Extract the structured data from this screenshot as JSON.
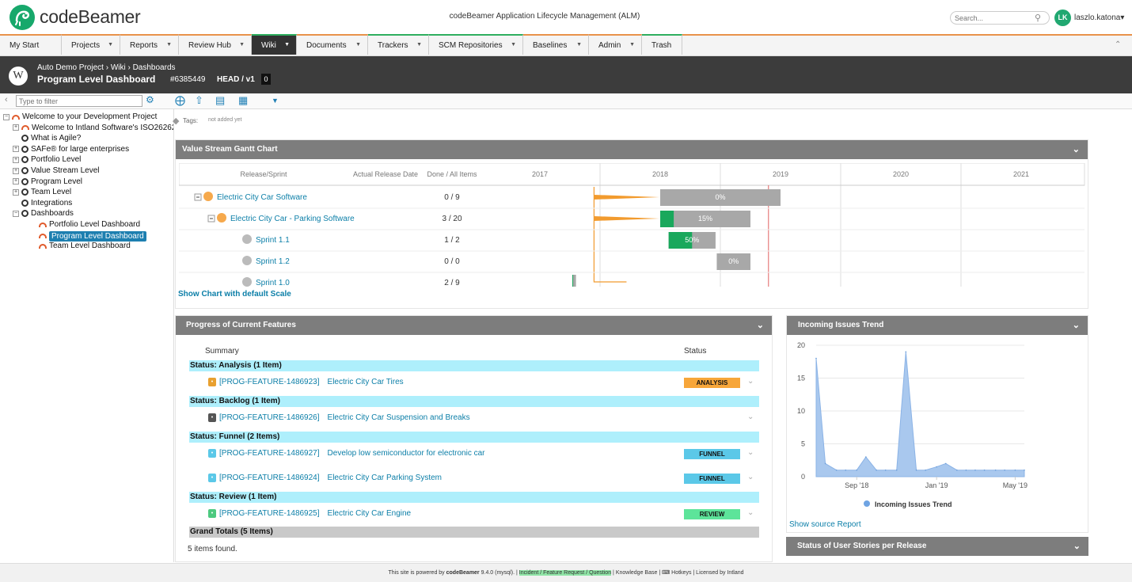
{
  "header": {
    "brand": "codeBeamer",
    "app_title": "codeBeamer Application Lifecycle Management (ALM)",
    "search_placeholder": "Search...",
    "avatar_initials": "LK",
    "username": "laszlo.katona▾"
  },
  "nav": {
    "tabs": [
      {
        "label": "My Start",
        "width": 78,
        "dd": false,
        "green": false,
        "active": false
      },
      {
        "label": "Projects",
        "width": 74,
        "dd": true,
        "green": false,
        "active": false
      },
      {
        "label": "Reports",
        "width": 74,
        "dd": true,
        "green": false,
        "active": false
      },
      {
        "label": "Review Hub",
        "width": 92,
        "dd": true,
        "green": false,
        "active": false
      },
      {
        "label": "Wiki",
        "width": 57,
        "dd": true,
        "green": true,
        "active": true
      },
      {
        "label": "Documents",
        "width": 90,
        "dd": true,
        "green": false,
        "active": false
      },
      {
        "label": "Trackers",
        "width": 77,
        "dd": true,
        "green": true,
        "active": false
      },
      {
        "label": "SCM Repositories",
        "width": 119,
        "dd": true,
        "green": true,
        "active": false
      },
      {
        "label": "Baselines",
        "width": 83,
        "dd": true,
        "green": false,
        "active": false
      },
      {
        "label": "Admin",
        "width": 67,
        "dd": true,
        "green": false,
        "active": false
      },
      {
        "label": "Trash",
        "width": 51,
        "dd": false,
        "green": true,
        "active": false
      }
    ]
  },
  "page": {
    "breadcrumb": "Auto Demo Project › Wiki › Dashboards",
    "title": "Program Level Dashboard",
    "id": "#6385449",
    "version": "HEAD / v1",
    "version_num": "0",
    "wiki_icon": "W"
  },
  "sidebar": {
    "filter_placeholder": "Type to filter",
    "tree": [
      {
        "label": "Welcome to your Development Project",
        "level": 0,
        "toggle": "−",
        "icon": "dashboard"
      },
      {
        "label": "Welcome to Intland Software's ISO26262",
        "level": 1,
        "toggle": "+",
        "icon": "dashboard"
      },
      {
        "label": "What is Agile?",
        "level": 1,
        "toggle": "",
        "icon": "page"
      },
      {
        "label": "SAFe® for large enterprises",
        "level": 1,
        "toggle": "+",
        "icon": "page"
      },
      {
        "label": "Portfolio Level",
        "level": 1,
        "toggle": "+",
        "icon": "page"
      },
      {
        "label": "Value Stream Level",
        "level": 1,
        "toggle": "+",
        "icon": "page"
      },
      {
        "label": "Program Level",
        "level": 1,
        "toggle": "+",
        "icon": "page"
      },
      {
        "label": "Team Level",
        "level": 1,
        "toggle": "+",
        "icon": "page"
      },
      {
        "label": "Integrations",
        "level": 1,
        "toggle": "",
        "icon": "page"
      },
      {
        "label": "Dashboards",
        "level": 1,
        "toggle": "−",
        "icon": "page"
      },
      {
        "label": "Portfolio Level Dashboard",
        "level": 2,
        "toggle": "",
        "icon": "dashboard"
      },
      {
        "label": "Program Level Dashboard",
        "level": 2,
        "toggle": "",
        "icon": "dashboard",
        "selected": true
      },
      {
        "label": "Team Level Dashboard",
        "level": 2,
        "toggle": "",
        "icon": "dashboard"
      }
    ]
  },
  "tags": {
    "label": "Tags:",
    "value": "not added yet"
  },
  "gantt": {
    "title": "Value Stream Gantt Chart",
    "col_release": "Release/Sprint",
    "col_date": "Actual Release Date",
    "col_done": "Done / All Items",
    "years": [
      "2017",
      "2018",
      "2019",
      "2020",
      "2021"
    ],
    "rows": [
      {
        "name": "Electric City Car Software",
        "indent": 0,
        "toggle": "−",
        "icon": "release",
        "done": "0 / 9",
        "start": 2018.0,
        "end": 2019.0,
        "pct": 0
      },
      {
        "name": "Electric City Car - Parking Software",
        "indent": 1,
        "toggle": "−",
        "icon": "release",
        "done": "3 / 20",
        "start": 2018.0,
        "end": 2018.75,
        "pct": 15
      },
      {
        "name": "Sprint 1.1",
        "indent": 2,
        "toggle": "",
        "icon": "sprint",
        "done": "1 / 2",
        "start": 2018.07,
        "end": 2018.46,
        "pct": 50
      },
      {
        "name": "Sprint 1.2",
        "indent": 2,
        "toggle": "",
        "icon": "sprint",
        "done": "0 / 0",
        "start": 2018.47,
        "end": 2018.75,
        "pct": 0
      },
      {
        "name": "Sprint 1.0",
        "indent": 2,
        "toggle": "",
        "icon": "sprint",
        "done": "2 / 9",
        "start": 2017.27,
        "end": 2017.3,
        "pct": 22
      }
    ],
    "link": "Show Chart with default Scale"
  },
  "features": {
    "title": "Progress of Current Features",
    "col_summary": "Summary",
    "col_status": "Status",
    "groups": [
      {
        "label": "Status: Analysis (1 Item)",
        "items": [
          {
            "key": "[PROG-FEATURE-1486923]",
            "name": "Electric City Car Tires",
            "status": "ANALYSIS",
            "badge_color": "#f7a63a",
            "icon_color": "#e8a030"
          }
        ]
      },
      {
        "label": "Status: Backlog (1 Item)",
        "items": [
          {
            "key": "[PROG-FEATURE-1486926]",
            "name": "Electric City Car Suspension and Breaks",
            "status": "",
            "badge_color": "",
            "icon_color": "#555555"
          }
        ]
      },
      {
        "label": "Status: Funnel (2 Items)",
        "items": [
          {
            "key": "[PROG-FEATURE-1486927]",
            "name": "Develop low semiconductor for electronic car",
            "status": "FUNNEL",
            "badge_color": "#5bc8e8",
            "icon_color": "#5bc8e8"
          },
          {
            "key": "[PROG-FEATURE-1486924]",
            "name": "Electric City Car Parking System",
            "status": "FUNNEL",
            "badge_color": "#5bc8e8",
            "icon_color": "#5bc8e8"
          }
        ]
      },
      {
        "label": "Status: Review (1 Item)",
        "items": [
          {
            "key": "[PROG-FEATURE-1486925]",
            "name": "Electric City Car Engine",
            "status": "REVIEW",
            "badge_color": "#5de49a",
            "icon_color": "#4cc97f"
          }
        ]
      }
    ],
    "grand_total": "Grand Totals (5 Items)",
    "found": "5 items found."
  },
  "trend": {
    "title": "Incoming Issues Trend",
    "link": "Show source Report"
  },
  "stories": {
    "title": "Status of User Stories per Release"
  },
  "chart_data": {
    "type": "area",
    "title": "Incoming Issues Trend",
    "series": [
      {
        "name": "Incoming Issues Trend",
        "color": "#a9c8ee",
        "x": [
          "2018-07-01",
          "2018-07-15",
          "2018-08-01",
          "2018-08-15",
          "2018-09-01",
          "2018-09-15",
          "2018-10-01",
          "2018-10-15",
          "2018-11-01",
          "2018-11-15",
          "2018-12-01",
          "2018-12-15",
          "2019-01-01",
          "2019-01-15",
          "2019-02-01",
          "2019-02-15",
          "2019-03-01",
          "2019-03-15",
          "2019-04-01",
          "2019-04-15",
          "2019-05-01",
          "2019-05-15"
        ],
        "values": [
          18,
          2,
          1,
          1,
          1,
          3,
          1,
          1,
          1,
          19,
          1,
          1,
          1.5,
          2,
          1,
          1,
          1,
          1,
          1,
          1,
          1,
          1
        ]
      }
    ],
    "x_ticks": [
      "Sep '18",
      "Jan '19",
      "May '19"
    ],
    "y_ticks": [
      0,
      5,
      10,
      15,
      20
    ],
    "ylim": [
      0,
      20
    ],
    "legend": "bottom",
    "grid": true
  },
  "footer": {
    "powered": "This site is powered by",
    "brand": "codeBeamer",
    "version": "9.4.0 (mysql).",
    "highlight": "Incident / Feature Request / Question",
    "kb": "Knowledge Base",
    "hotkeys": "Hotkeys",
    "license": "Licensed by",
    "licensor": "Intland"
  }
}
